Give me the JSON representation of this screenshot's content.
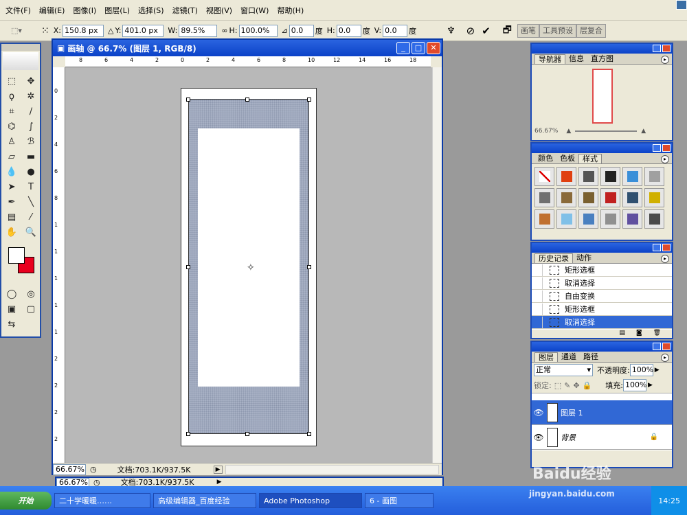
{
  "menu": [
    "文件(F)",
    "编辑(E)",
    "图像(I)",
    "图层(L)",
    "选择(S)",
    "滤镜(T)",
    "视图(V)",
    "窗口(W)",
    "帮助(H)"
  ],
  "options": {
    "x_label": "X:",
    "x_value": "150.8 px",
    "y_label": "Y:",
    "y_value": "401.0 px",
    "w_label": "W:",
    "w_value": "89.5%",
    "h_label": "H:",
    "h_value": "100.0%",
    "angle_value": "0.0",
    "angle_unit": "度",
    "hskew_label": "H:",
    "hskew_value": "0.0",
    "hskew_unit": "度",
    "vskew_label": "V:",
    "vskew_value": "0.0",
    "vskew_unit": "度",
    "tab_brush": "画笔",
    "tab_tool_presets": "工具预设",
    "tab_comp": "层复合"
  },
  "document": {
    "title": "画轴 @ 66.7% (图层 1, RGB/8)",
    "zoom": "66.67%",
    "doc_info": "文档:703.1K/937.5K",
    "ruler_h": [
      "8",
      "6",
      "4",
      "2",
      "0",
      "2",
      "4",
      "6",
      "8",
      "10",
      "12",
      "14",
      "16",
      "18"
    ],
    "ruler_v": [
      "0",
      "2",
      "4",
      "6",
      "8",
      "1",
      "1",
      "1",
      "1",
      "1",
      "2",
      "2",
      "2",
      "2"
    ]
  },
  "second_status": {
    "zoom": "66.67%",
    "doc_info": "文档:703.1K/937.5K"
  },
  "navigator": {
    "tabs": [
      "导航器",
      "信息",
      "直方图"
    ],
    "zoom": "66.67%"
  },
  "styles_panel": {
    "tabs": [
      "颜色",
      "色板",
      "样式"
    ],
    "swatches": [
      "#ffffff",
      "#e04010",
      "#555555",
      "#222222",
      "#3a8fd8",
      "#a0a0a0",
      "#707070",
      "#8a6a3a",
      "#7a6030",
      "#c02020",
      "#305070",
      "#d0b000",
      "#c07030",
      "#80c0e8",
      "#4a80c0",
      "#909090",
      "#6050a0",
      "#4a4a4a"
    ]
  },
  "history": {
    "tabs": [
      "历史记录",
      "动作"
    ],
    "items": [
      "矩形选框",
      "取消选择",
      "自由变换",
      "矩形选框",
      "取消选择"
    ],
    "selected": 4
  },
  "layers": {
    "tabs": [
      "图层",
      "通道",
      "路径"
    ],
    "blend_mode": "正常",
    "opacity_label": "不透明度:",
    "opacity": "100%",
    "lock_label": "锁定:",
    "fill_label": "填充:",
    "fill": "100%",
    "items": [
      {
        "name": "图层 1",
        "selected": true
      },
      {
        "name": "背景",
        "selected": false
      }
    ]
  },
  "taskbar": {
    "start": "开始",
    "items": [
      "二十学暖暖……",
      "高级编辑器_百度经验",
      "Adobe Photoshop",
      "6 - 画图"
    ],
    "time": "14:25"
  },
  "watermark": {
    "logo": "Baidu经验",
    "url": "jingyan.baidu.com"
  }
}
